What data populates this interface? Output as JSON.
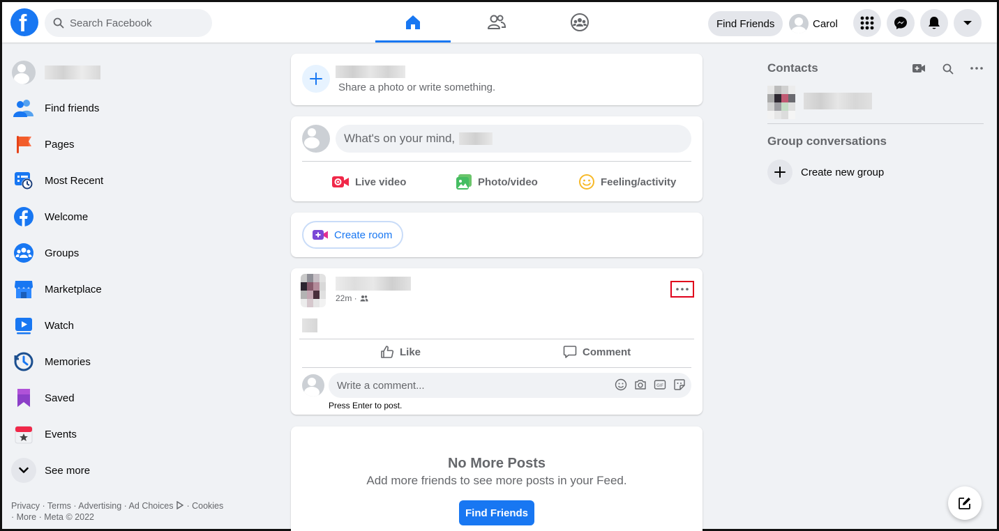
{
  "header": {
    "search_placeholder": "Search Facebook",
    "find_friends": "Find Friends",
    "profile_name": "Carol"
  },
  "sidebar": {
    "items": [
      {
        "label": "Find friends",
        "icon": "friends-icon"
      },
      {
        "label": "Pages",
        "icon": "pages-flag-icon"
      },
      {
        "label": "Most Recent",
        "icon": "most-recent-icon"
      },
      {
        "label": "Welcome",
        "icon": "facebook-icon"
      },
      {
        "label": "Groups",
        "icon": "groups-icon"
      },
      {
        "label": "Marketplace",
        "icon": "marketplace-icon"
      },
      {
        "label": "Watch",
        "icon": "watch-icon"
      },
      {
        "label": "Memories",
        "icon": "memories-clock-icon"
      },
      {
        "label": "Saved",
        "icon": "saved-bookmark-icon"
      },
      {
        "label": "Events",
        "icon": "events-calendar-icon"
      },
      {
        "label": "See more",
        "icon": "chevron-down-icon"
      }
    ],
    "footer": {
      "line1": "Privacy · Terms · Advertising · Ad Choices",
      "cookies": "· Cookies",
      "line2": "· More · Meta © 2022"
    }
  },
  "feed": {
    "share_prompt": "Share a photo or write something.",
    "composer_placeholder": "What's on your mind,",
    "composer_actions": {
      "live": "Live video",
      "photo": "Photo/video",
      "feeling": "Feeling/activity"
    },
    "create_room": "Create room",
    "post": {
      "time": "22m ·",
      "like": "Like",
      "comment": "Comment",
      "comment_placeholder": "Write a comment...",
      "hint": "Press Enter to post."
    },
    "end": {
      "title": "No More Posts",
      "subtitle": "Add more friends to see more posts in your Feed.",
      "button": "Find Friends"
    }
  },
  "right": {
    "contacts_title": "Contacts",
    "group_title": "Group conversations",
    "create_group": "Create new group"
  },
  "colors": {
    "brand": "#1877f2",
    "background": "#f0f2f5",
    "highlight": "#e0001b"
  }
}
